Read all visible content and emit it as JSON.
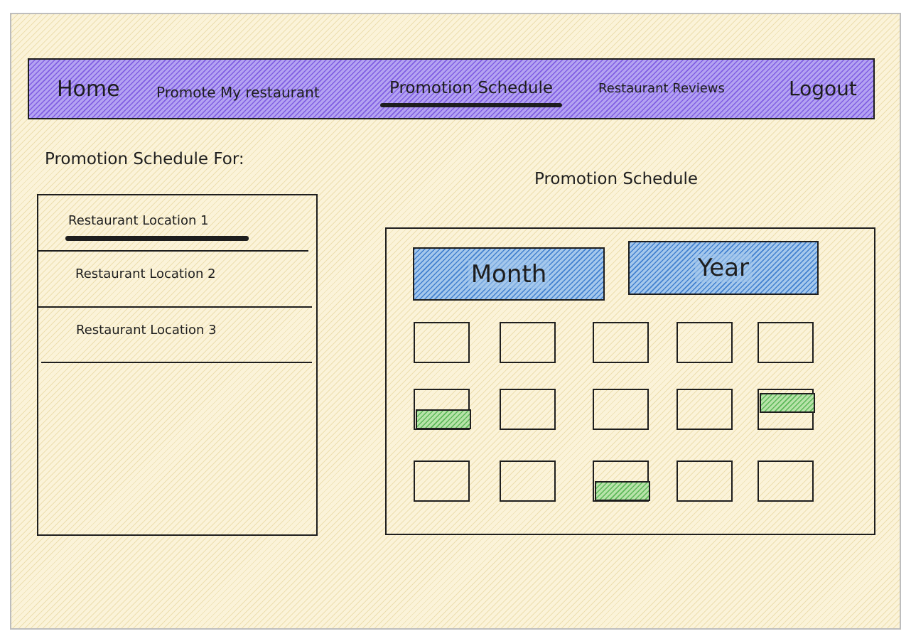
{
  "nav": {
    "home": "Home",
    "promote": "Promote My restaurant",
    "schedule": "Promotion Schedule",
    "reviews": "Restaurant Reviews",
    "logout": "Logout",
    "active": "Promotion Schedule"
  },
  "sidebar": {
    "title": "Promotion Schedule For:",
    "locations": [
      {
        "label": "Restaurant Location 1",
        "selected": true
      },
      {
        "label": "Restaurant Location 2",
        "selected": false
      },
      {
        "label": "Restaurant Location 3",
        "selected": false
      }
    ]
  },
  "schedule": {
    "title": "Promotion Schedule",
    "view_buttons": [
      "Month",
      "Year"
    ],
    "grid": {
      "rows": 3,
      "columns": 5,
      "promoted_cells": [
        {
          "row": 2,
          "col": 1,
          "band": "bottom"
        },
        {
          "row": 2,
          "col": 5,
          "band": "top"
        },
        {
          "row": 3,
          "col": 3,
          "band": "bottom"
        }
      ]
    }
  },
  "colors": {
    "background": "#fbf3d9",
    "nav_fill": "#b4a3f2",
    "button_fill": "#a5c8ec",
    "promo_fill": "#b7e3a9",
    "stroke": "#1e1e1e"
  }
}
